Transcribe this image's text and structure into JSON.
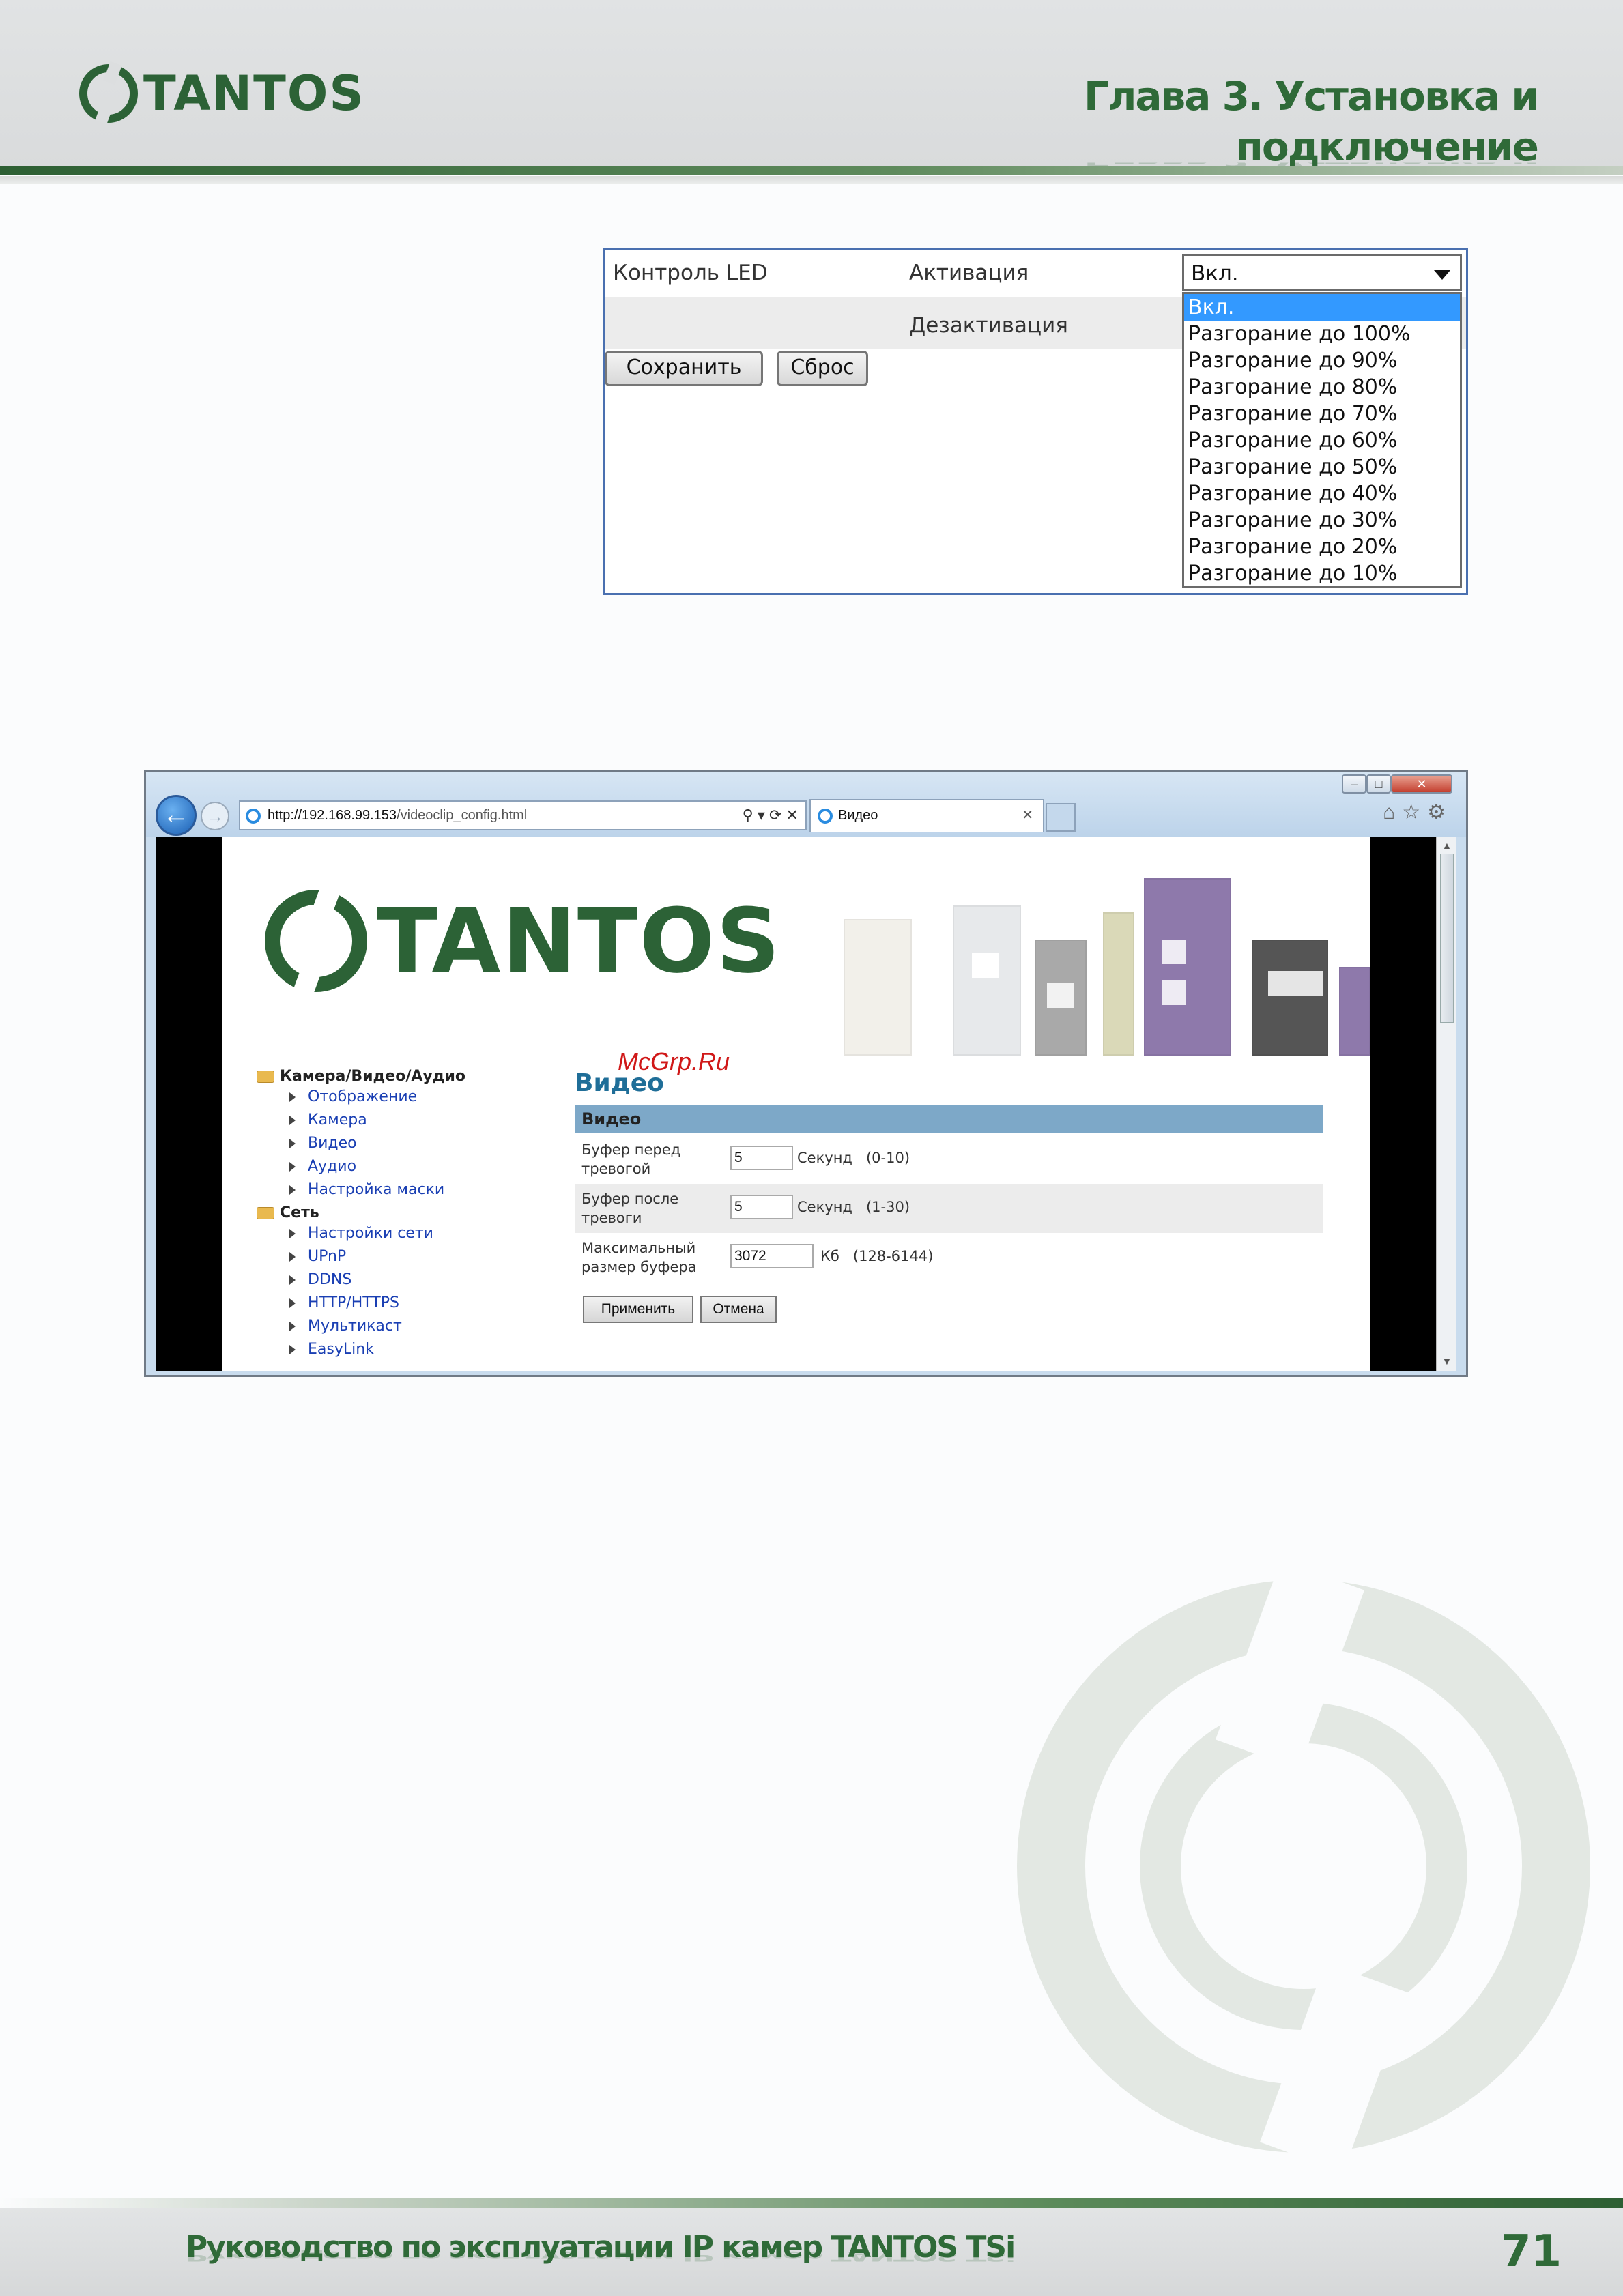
{
  "header": {
    "logo_text": "TANTOS",
    "chapter": "Глава 3. Установка и подключение"
  },
  "led_panel": {
    "label": "Контроль LED",
    "activation": "Активация",
    "deactivation": "Дезактивация",
    "save": "Сохранить",
    "reset": "Сброс",
    "selected": "Вкл.",
    "options": [
      "Вкл.",
      "Разгорание до 100%",
      "Разгорание до 90%",
      "Разгорание до 80%",
      "Разгорание до 70%",
      "Разгорание до 60%",
      "Разгорание до 50%",
      "Разгорание до 40%",
      "Разгорание до 30%",
      "Разгорание до 20%",
      "Разгорание до 10%"
    ]
  },
  "browser": {
    "url_host": "http://192.168.99.153",
    "url_path": "/videoclip_config.html",
    "tab_title": "Видео",
    "logo_text": "TANTOS",
    "menu": {
      "group1": "Камера/Видео/Аудио",
      "group1_items": [
        "Отображение",
        "Камера",
        "Видео",
        "Аудио",
        "Настройка маски"
      ],
      "group2": "Сеть",
      "group2_items": [
        "Настройки сети",
        "UPnP",
        "DDNS",
        "HTTP/HTTPS",
        "Мультикаст",
        "EasyLink"
      ]
    },
    "page_heading": "Видео",
    "section_title": "Видео",
    "rows": [
      {
        "label": "Буфер перед тревогой",
        "value": "5",
        "unit": "Секунд",
        "range": "(0-10)"
      },
      {
        "label": "Буфер после тревоги",
        "value": "5",
        "unit": "Секунд",
        "range": "(1-30)"
      },
      {
        "label": "Максимальный размер буфера",
        "value": "3072",
        "unit": "Кб",
        "range": "(128-6144)"
      }
    ],
    "apply": "Применить",
    "cancel": "Отмена"
  },
  "watermark": "McGrp.Ru",
  "footer": {
    "title": "Руководство по эксплуатации IP камер TANTOS TSi",
    "page_number": "71"
  },
  "colors": {
    "brand_green": "#2c6236",
    "link_blue": "#1a3fb3",
    "highlight": "#3399ff"
  }
}
